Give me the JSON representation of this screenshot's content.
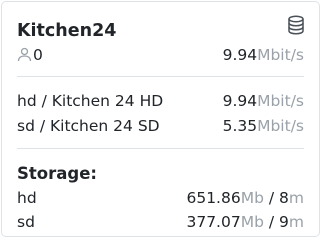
{
  "header": {
    "title": "Kitchen24",
    "viewers": "0",
    "bitrate_value": "9.94",
    "bitrate_unit": "Mbit/s"
  },
  "streams": [
    {
      "name": "hd / Kitchen 24 HD",
      "value": "9.94",
      "unit": "Mbit/s"
    },
    {
      "name": "sd / Kitchen 24 SD",
      "value": "5.35",
      "unit": "Mbit/s"
    }
  ],
  "storage": {
    "title": "Storage:",
    "items": [
      {
        "name": "hd",
        "size": "651.86",
        "size_unit": "Mb",
        "sep": " / ",
        "duration": "8",
        "duration_unit": "m"
      },
      {
        "name": "sd",
        "size": "377.07",
        "size_unit": "Mb",
        "sep": " / ",
        "duration": "9",
        "duration_unit": "m"
      }
    ]
  },
  "icons": {
    "database": "database-icon",
    "viewers": "user-icon"
  },
  "colors": {
    "text": "#212529",
    "unit": "#9aa1a8",
    "border": "#dfe3e8"
  }
}
